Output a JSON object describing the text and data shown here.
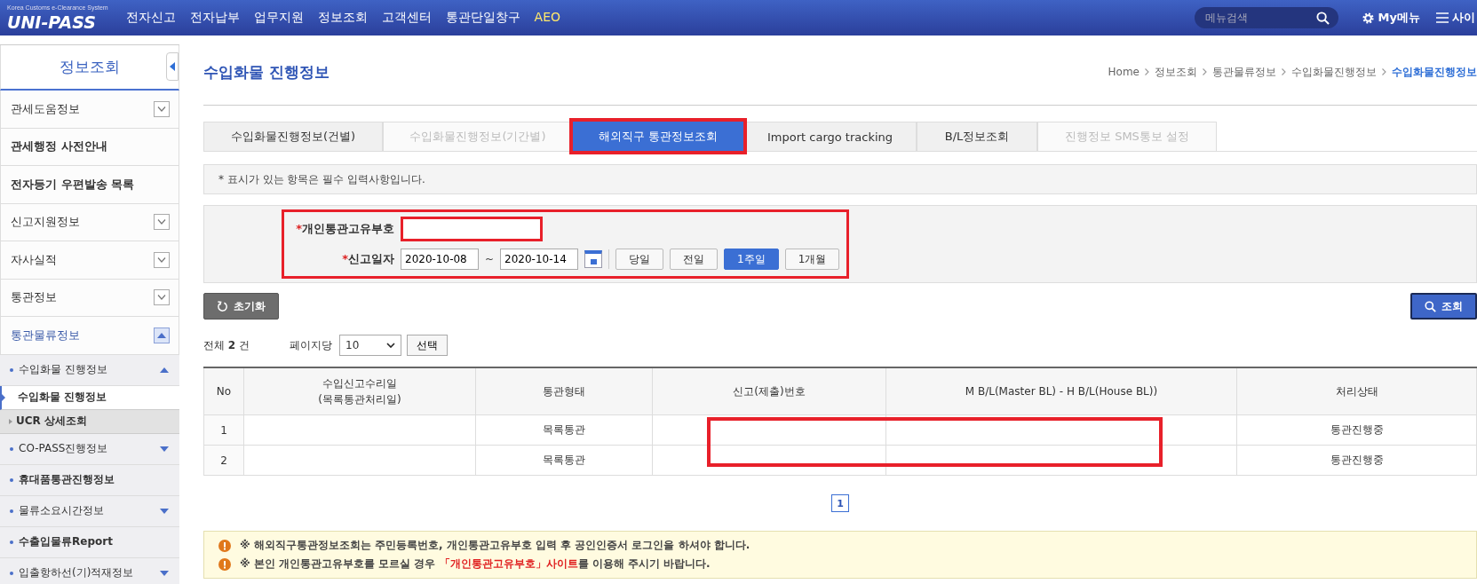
{
  "header": {
    "logo_tagline": "Korea Customs e-Clearance System",
    "logo": "UNI-PASS",
    "menu": [
      "전자신고",
      "전자납부",
      "업무지원",
      "정보조회",
      "고객센터",
      "통관단일창구",
      "AEO"
    ],
    "search": {
      "placeholder": "메뉴검색"
    },
    "my_menu": "My메뉴",
    "sitemap": "사이"
  },
  "sidebar": {
    "title": "정보조회",
    "items": [
      {
        "label": "관세도움정보",
        "kind": "group",
        "expanded": false
      },
      {
        "label": "관세행정 사전안내",
        "kind": "link"
      },
      {
        "label": "전자등기 우편발송 목록",
        "kind": "link"
      },
      {
        "label": "신고지원정보",
        "kind": "group",
        "expanded": false
      },
      {
        "label": "자사실적",
        "kind": "group",
        "expanded": false
      },
      {
        "label": "통관정보",
        "kind": "group",
        "expanded": false
      },
      {
        "label": "통관물류정보",
        "kind": "group",
        "expanded": true,
        "children": [
          {
            "label": "수입화물 진행정보",
            "kind": "group",
            "expanded": true,
            "children": [
              {
                "label": "수입화물 진행정보",
                "selected": true
              },
              {
                "label": "UCR 상세조회",
                "selected": false
              }
            ]
          },
          {
            "label": "CO-PASS진행정보",
            "kind": "group",
            "expanded": false
          },
          {
            "label": "휴대품통관진행정보",
            "kind": "link"
          },
          {
            "label": "물류소요시간정보",
            "kind": "group",
            "expanded": false
          },
          {
            "label": "수출입물류Report",
            "kind": "link"
          },
          {
            "label": "입출항하선(기)적재정보",
            "kind": "group",
            "expanded": false
          }
        ]
      }
    ]
  },
  "page": {
    "title": "수입화물 진행정보",
    "breadcrumb": [
      "Home",
      "정보조회",
      "통관물류정보",
      "수입화물진행정보",
      "수입화물진행정보"
    ]
  },
  "tabs": [
    {
      "label": "수입화물진행정보(건별)",
      "selected": false,
      "disabled": false,
      "highlighted": false
    },
    {
      "label": "수입화물진행정보(기간별)",
      "selected": false,
      "disabled": true,
      "highlighted": false
    },
    {
      "label": "해외직구 통관정보조회",
      "selected": true,
      "disabled": false,
      "highlighted": true
    },
    {
      "label": "Import cargo tracking",
      "selected": false,
      "disabled": false,
      "highlighted": false
    },
    {
      "label": "B/L정보조회",
      "selected": false,
      "disabled": false,
      "highlighted": false
    },
    {
      "label": "진행정보 SMS통보 설정",
      "selected": false,
      "disabled": true,
      "highlighted": false
    }
  ],
  "required_note": "* 표시가 있는 항목은 필수 입력사항입니다.",
  "form": {
    "highlighted": true,
    "customs_code": {
      "required_mark": "*",
      "label": "개인통관고유부호",
      "highlighted": true
    },
    "date": {
      "required_mark": "*",
      "label": "신고일자",
      "from": "2020-10-08",
      "separator": "~",
      "to": "2020-10-14"
    },
    "periods": [
      {
        "label": "당일",
        "selected": false
      },
      {
        "label": "전일",
        "selected": false
      },
      {
        "label": "1주일",
        "selected": true
      },
      {
        "label": "1개월",
        "selected": false
      }
    ]
  },
  "reset_button": "초기화",
  "search_button": "조회",
  "summary": {
    "total_label": "전체",
    "total": "2",
    "unit": "건",
    "per_page_label": "페이지당",
    "per_page": "10",
    "select_button": "선택"
  },
  "table": {
    "columns": [
      "No",
      "수입신고수리일\n(목록통관처리일)",
      "통관형태",
      "신고(제출)번호",
      "M B/L(Master BL) - H B/L(House BL))",
      "처리상태"
    ],
    "rows": [
      [
        "1",
        "",
        "목록통관",
        "",
        "",
        "통관진행중"
      ],
      [
        "2",
        "",
        "목록통관",
        "",
        "",
        "통관진행중"
      ]
    ],
    "highlighted": true
  },
  "pagination": [
    {
      "label": "1",
      "selected": true
    }
  ],
  "notices": [
    {
      "text": "※ 해외직구통관정보조회는 주민등록번호, 개인통관고유부호 입력 후 공인인증서 로그인을 하셔야 합니다."
    },
    {
      "text": "※ 본인 개인통관고유부호를 모르실 경우 ",
      "link": "「개인통관고유부호」사이트",
      "after": "를 이용해 주시기 바랍니다."
    }
  ]
}
